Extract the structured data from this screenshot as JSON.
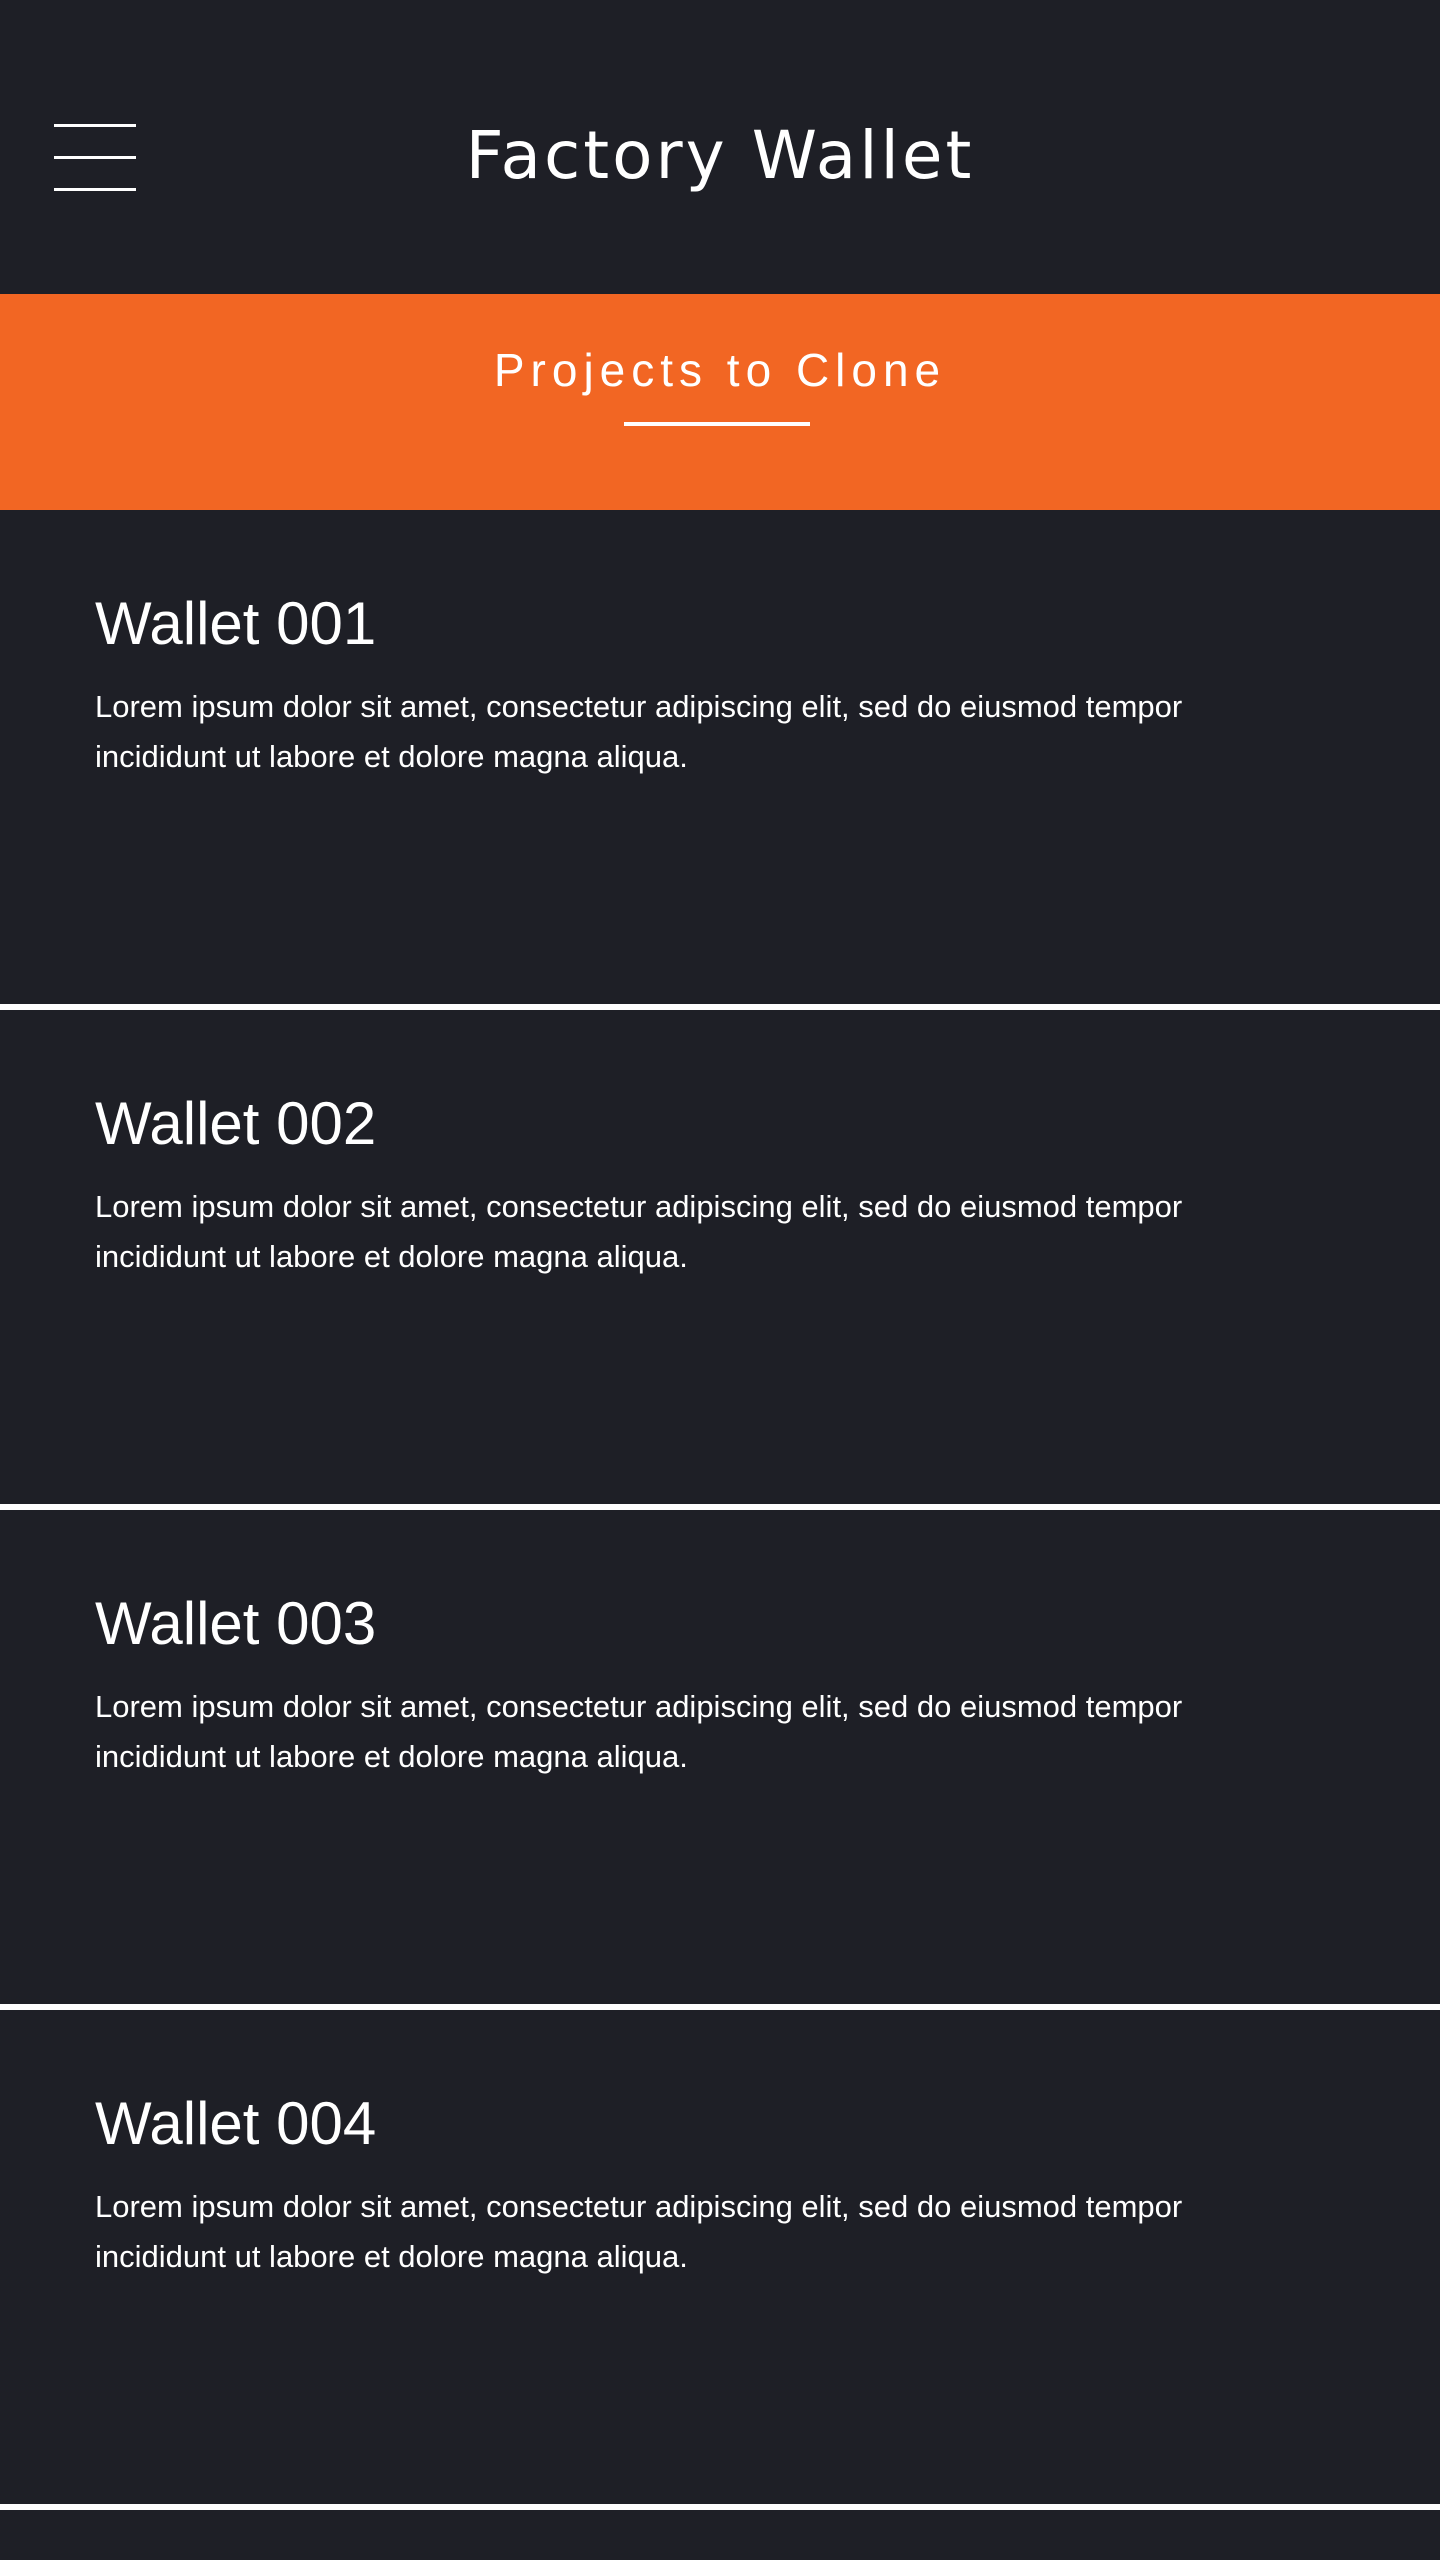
{
  "header": {
    "title": "Factory Wallet",
    "menu_icon": "hamburger-menu-icon"
  },
  "banner": {
    "title": "Projects to Clone",
    "background_color": "#f26623"
  },
  "theme": {
    "background_color": "#1e1f26",
    "text_color": "#ffffff"
  },
  "wallets": [
    {
      "name": "Wallet 001",
      "description": "Lorem ipsum dolor sit amet, consectetur adipiscing elit, sed do eiusmod tempor incididunt ut labore et dolore magna aliqua."
    },
    {
      "name": "Wallet 002",
      "description": "Lorem ipsum dolor sit amet, consectetur adipiscing elit, sed do eiusmod tempor incididunt ut labore et dolore magna aliqua."
    },
    {
      "name": "Wallet 003",
      "description": "Lorem ipsum dolor sit amet, consectetur adipiscing elit, sed do eiusmod tempor incididunt ut labore et dolore magna aliqua."
    },
    {
      "name": "Wallet 004",
      "description": "Lorem ipsum dolor sit amet, consectetur adipiscing elit, sed do eiusmod tempor incididunt ut labore et dolore magna aliqua."
    }
  ]
}
